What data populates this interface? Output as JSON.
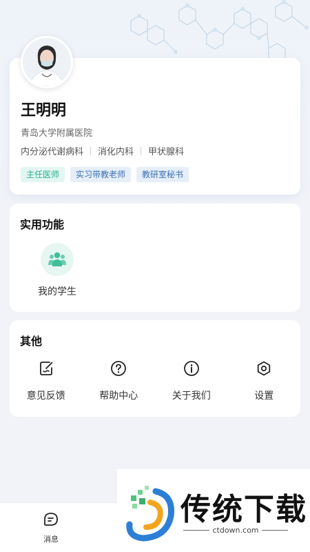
{
  "profile": {
    "name": "王明明",
    "hospital": "青岛大学附属医院",
    "departments": [
      "内分泌代谢病科",
      "消化内科",
      "甲状腺科"
    ],
    "tags": [
      {
        "label": "主任医师",
        "style": "green"
      },
      {
        "label": "实习带教老师",
        "style": "blue"
      },
      {
        "label": "教研室秘书",
        "style": "blue"
      }
    ]
  },
  "functions": {
    "title": "实用功能",
    "items": [
      {
        "label": "我的学生",
        "icon": "students-icon"
      }
    ]
  },
  "other": {
    "title": "其他",
    "items": [
      {
        "label": "意见反馈",
        "icon": "feedback-icon"
      },
      {
        "label": "帮助中心",
        "icon": "help-icon"
      },
      {
        "label": "关于我们",
        "icon": "info-icon"
      },
      {
        "label": "设置",
        "icon": "settings-icon"
      }
    ]
  },
  "tabbar": {
    "message_label": "消息"
  },
  "watermark": {
    "title": "传统下载",
    "url": "ctdown.com"
  },
  "colors": {
    "accent_green": "#2bb08e",
    "accent_blue": "#3c6fb5",
    "background": "#f1f3f8"
  }
}
